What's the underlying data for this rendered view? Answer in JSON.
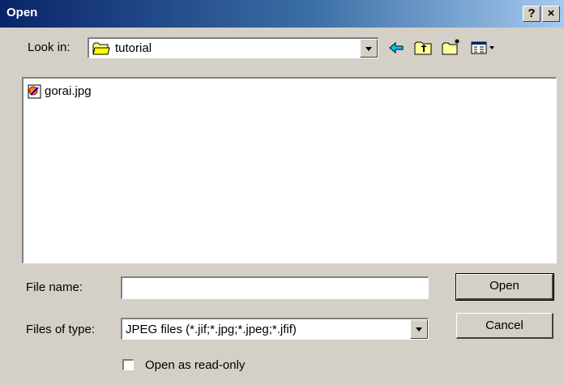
{
  "window": {
    "title": "Open",
    "help_glyph": "?",
    "close_glyph": "×"
  },
  "look_in": {
    "label": "Look in:",
    "value": "tutorial"
  },
  "toolbar_icons": [
    "back-icon",
    "up-folder-icon",
    "new-folder-icon",
    "view-menu-icon"
  ],
  "files": [
    {
      "name": "gorai.jpg",
      "icon": "jpeg-file-icon"
    }
  ],
  "file_name": {
    "label": "File name:",
    "value": ""
  },
  "file_type": {
    "label": "Files of type:",
    "value": "JPEG files (*.jif;*.jpg;*.jpeg;*.jfif)"
  },
  "readonly": {
    "label": "Open as read-only",
    "checked": false
  },
  "buttons": {
    "open": "Open",
    "cancel": "Cancel"
  },
  "colors": {
    "title_bar_start": "#0a246a",
    "title_bar_end": "#a6caf0",
    "face": "#d4d0c8"
  }
}
